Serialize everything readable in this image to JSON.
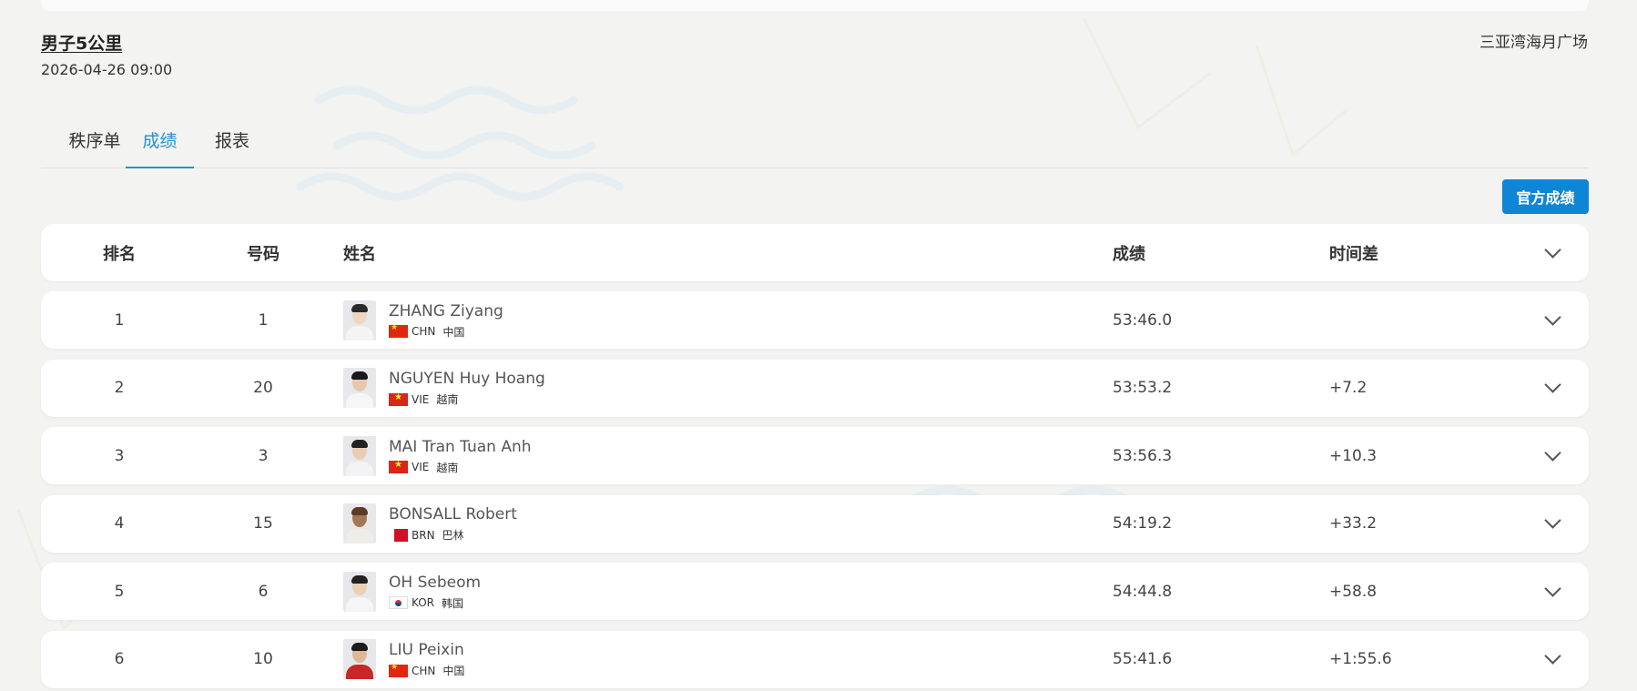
{
  "event": {
    "title": "男子5公里",
    "datetime": "2026-04-26 09:00",
    "venue": "三亚湾海月广场"
  },
  "tabs": [
    {
      "label": "秩序单",
      "active": false
    },
    {
      "label": "成绩",
      "active": true
    },
    {
      "label": "报表",
      "active": false
    }
  ],
  "official_button": "官方成绩",
  "table": {
    "headers": {
      "rank": "排名",
      "bib": "号码",
      "name": "姓名",
      "result": "成绩",
      "gap": "时间差"
    },
    "rows": [
      {
        "rank": "1",
        "bib": "1",
        "name": "ZHANG Ziyang",
        "code": "CHN",
        "country": "中国",
        "flag": "chn",
        "result": "53:46.0",
        "gap": ""
      },
      {
        "rank": "2",
        "bib": "20",
        "name": "NGUYEN Huy Hoang",
        "code": "VIE",
        "country": "越南",
        "flag": "vie",
        "result": "53:53.2",
        "gap": "+7.2"
      },
      {
        "rank": "3",
        "bib": "3",
        "name": "MAI Tran Tuan Anh",
        "code": "VIE",
        "country": "越南",
        "flag": "vie",
        "result": "53:56.3",
        "gap": "+10.3"
      },
      {
        "rank": "4",
        "bib": "15",
        "name": "BONSALL Robert",
        "code": "BRN",
        "country": "巴林",
        "flag": "brn",
        "result": "54:19.2",
        "gap": "+33.2"
      },
      {
        "rank": "5",
        "bib": "6",
        "name": "OH Sebeom",
        "code": "KOR",
        "country": "韩国",
        "flag": "kor",
        "result": "54:44.8",
        "gap": "+58.8"
      },
      {
        "rank": "6",
        "bib": "10",
        "name": "LIU Peixin",
        "code": "CHN",
        "country": "中国",
        "flag": "chn",
        "result": "55:41.6",
        "gap": "+1:55.6"
      }
    ]
  }
}
